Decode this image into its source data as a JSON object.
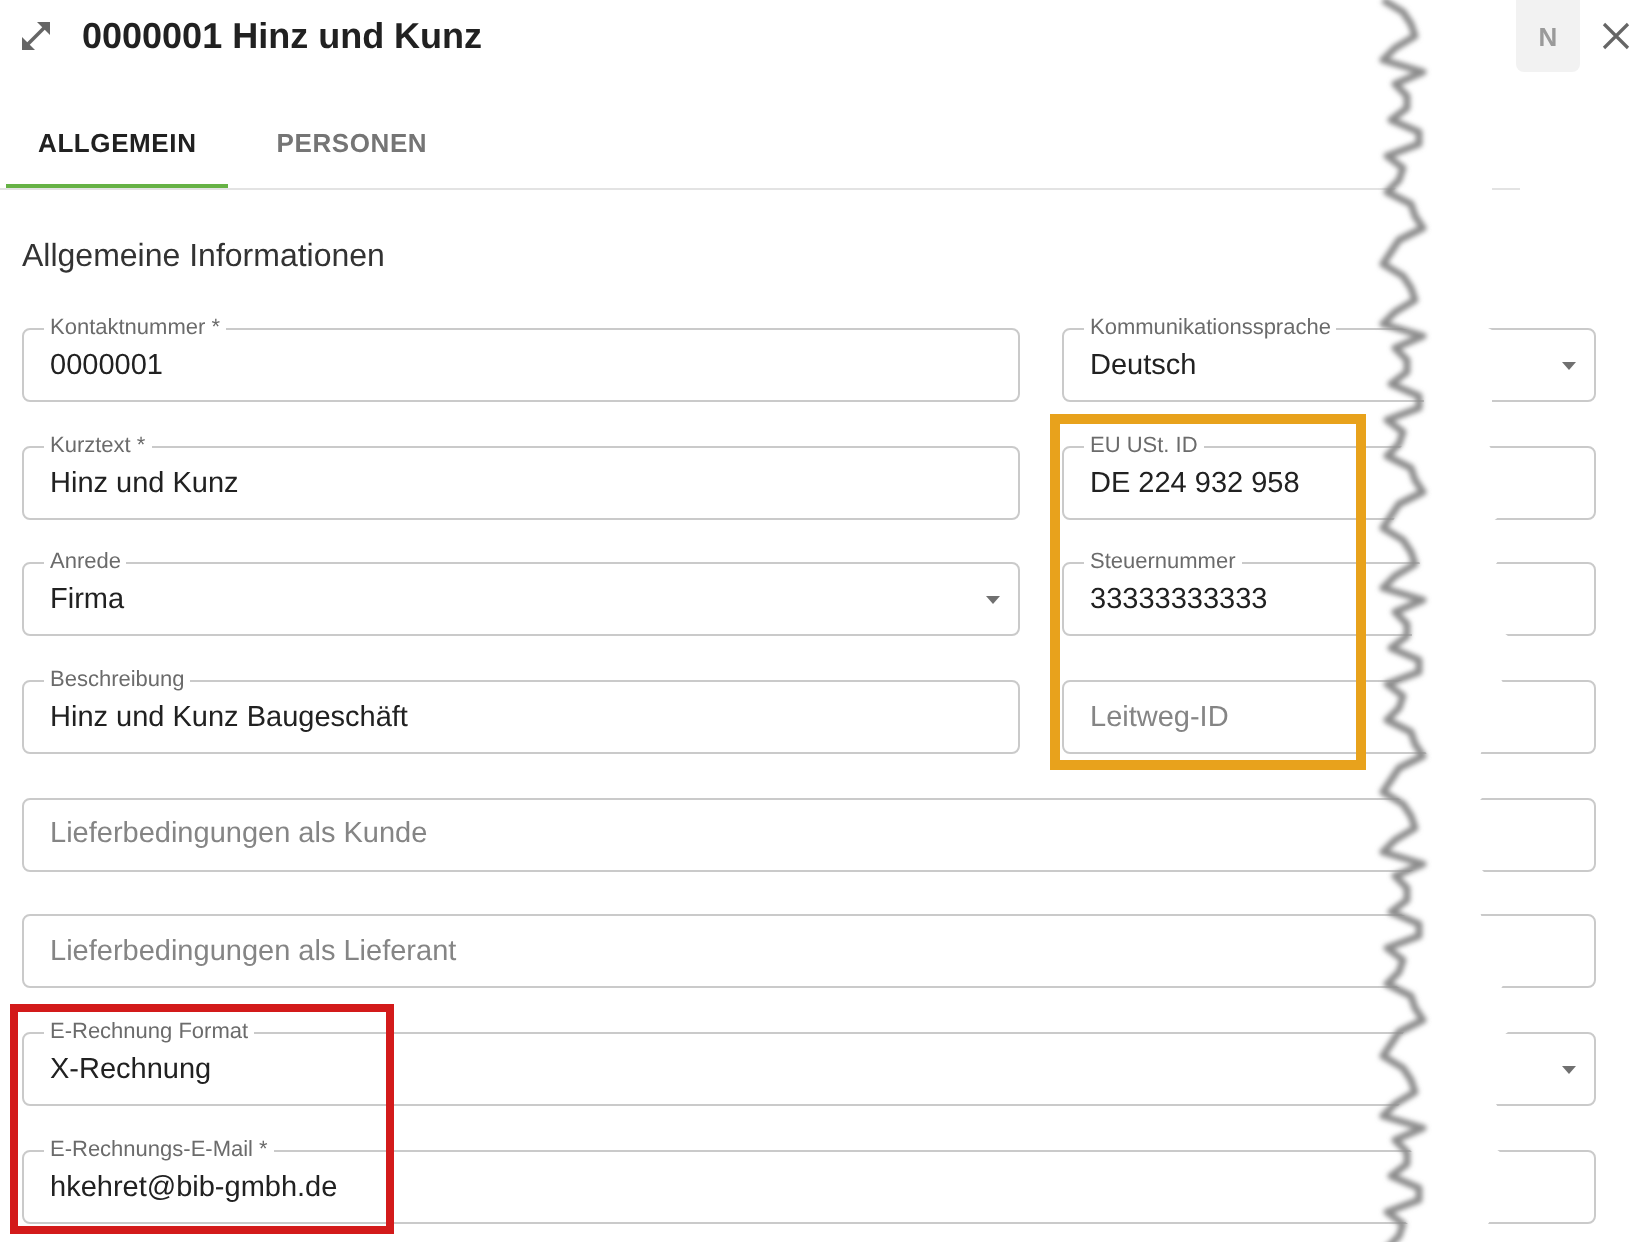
{
  "header": {
    "title": "0000001 Hinz und Kunz",
    "button": {
      "label": "N",
      "disabled": true
    }
  },
  "tabs": [
    {
      "label": "ALLGEMEIN",
      "selected": true
    },
    {
      "label": "PERSONEN",
      "selected": false
    }
  ],
  "section": {
    "title": "Allgemeine Informationen"
  },
  "rows": [
    {
      "fields": [
        {
          "kind": "text",
          "label": "Kontaktnummer *",
          "value": "0000001"
        },
        {
          "kind": "select",
          "label": "Kommunikationssprache",
          "value": "Deutsch"
        }
      ]
    },
    {
      "fields": [
        {
          "kind": "text",
          "label": "Kurztext *",
          "value": "Hinz und Kunz"
        },
        {
          "kind": "text",
          "label": "EU USt. ID",
          "value": "DE 224 932 958"
        }
      ]
    },
    {
      "fields": [
        {
          "kind": "select",
          "label": "Anrede",
          "value": "Firma"
        },
        {
          "kind": "text",
          "label": "Steuernummer",
          "value": "33333333333"
        }
      ]
    },
    {
      "fields": [
        {
          "kind": "text",
          "label": "Beschreibung",
          "value": "Hinz und Kunz Baugeschäft"
        },
        {
          "kind": "text",
          "placeholder": "Leitweg-ID"
        }
      ]
    },
    {
      "fields": [
        {
          "kind": "text",
          "placeholder": "Lieferbedingungen als Kunde"
        }
      ]
    },
    {
      "fields": [
        {
          "kind": "text",
          "placeholder": "Lieferbedingungen als Lieferant"
        }
      ]
    },
    {
      "fields": [
        {
          "kind": "select",
          "label": "E-Rechnung Format",
          "value": "X-Rechnung"
        }
      ]
    },
    {
      "fields": [
        {
          "kind": "text",
          "label": "E-Rechnungs-E-Mail *",
          "value": "hkehret@bib-gmbh.de"
        }
      ]
    }
  ],
  "highlights": [
    {
      "color": "#e8a21c"
    },
    {
      "color": "#d31a1a"
    }
  ]
}
